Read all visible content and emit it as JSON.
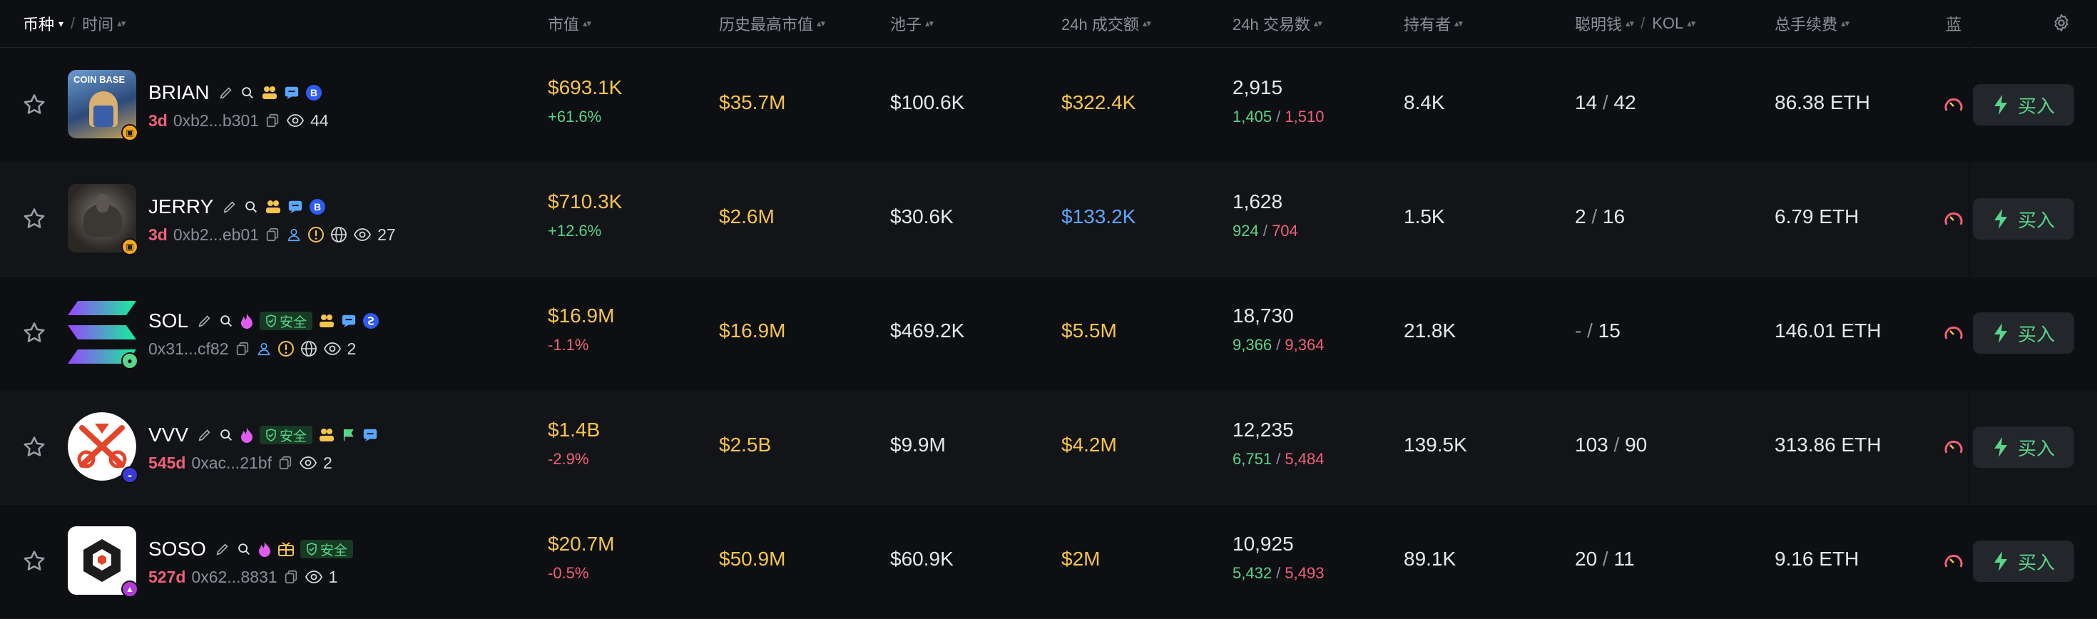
{
  "header": {
    "coin": "币种",
    "time": "时间",
    "market_cap": "市值",
    "ath_market_cap": "历史最高市值",
    "pool": "池子",
    "volume_24h": "24h 成交额",
    "txns_24h": "24h 交易数",
    "holders": "持有者",
    "smart_money": "聪明钱",
    "kol": "KOL",
    "total_fees": "总手续费",
    "bluechip": "蓝"
  },
  "colors": {
    "background": "#0e0f12",
    "row_alt": "#131417",
    "yellow": "#f5c44f",
    "green": "#5ad48a",
    "red": "#f0607a",
    "blue": "#5aa7ff"
  },
  "rows": [
    {
      "ticker": "BRIAN",
      "age": "3d",
      "address": "0xb2...b301",
      "views": "44",
      "safe": "",
      "market_cap": "$693.1K",
      "change": "+61.6%",
      "ath": "$35.7M",
      "pool": "$100.6K",
      "volume": "$322.4K",
      "txns": "2,915",
      "buys": "1,405",
      "sells": "1,510",
      "holders": "8.4K",
      "smart_money": "14",
      "kol": "42",
      "fees": "86.38 ETH",
      "buy_label": "买入",
      "avatar_text": "COIN BASE"
    },
    {
      "ticker": "JERRY",
      "age": "3d",
      "address": "0xb2...eb01",
      "views": "27",
      "safe": "",
      "market_cap": "$710.3K",
      "change": "+12.6%",
      "ath": "$2.6M",
      "pool": "$30.6K",
      "volume": "$133.2K",
      "txns": "1,628",
      "buys": "924",
      "sells": "704",
      "holders": "1.5K",
      "smart_money": "2",
      "kol": "16",
      "fees": "6.79 ETH",
      "buy_label": "买入"
    },
    {
      "ticker": "SOL",
      "age": "",
      "address": "0x31...cf82",
      "views": "2",
      "safe": "安全",
      "market_cap": "$16.9M",
      "change": "-1.1%",
      "ath": "$16.9M",
      "pool": "$469.2K",
      "volume": "$5.5M",
      "txns": "18,730",
      "buys": "9,366",
      "sells": "9,364",
      "holders": "21.8K",
      "smart_money": "-",
      "kol": "15",
      "fees": "146.01 ETH",
      "buy_label": "买入"
    },
    {
      "ticker": "VVV",
      "age": "545d",
      "address": "0xac...21bf",
      "views": "2",
      "safe": "安全",
      "market_cap": "$1.4B",
      "change": "-2.9%",
      "ath": "$2.5B",
      "pool": "$9.9M",
      "volume": "$4.2M",
      "txns": "12,235",
      "buys": "6,751",
      "sells": "5,484",
      "holders": "139.5K",
      "smart_money": "103",
      "kol": "90",
      "fees": "313.86 ETH",
      "buy_label": "买入"
    },
    {
      "ticker": "SOSO",
      "age": "527d",
      "address": "0x62...8831",
      "views": "1",
      "safe": "安全",
      "market_cap": "$20.7M",
      "change": "-0.5%",
      "ath": "$50.9M",
      "pool": "$60.9K",
      "volume": "$2M",
      "txns": "10,925",
      "buys": "5,432",
      "sells": "5,493",
      "holders": "89.1K",
      "smart_money": "20",
      "kol": "11",
      "fees": "9.16 ETH",
      "buy_label": "买入"
    }
  ]
}
